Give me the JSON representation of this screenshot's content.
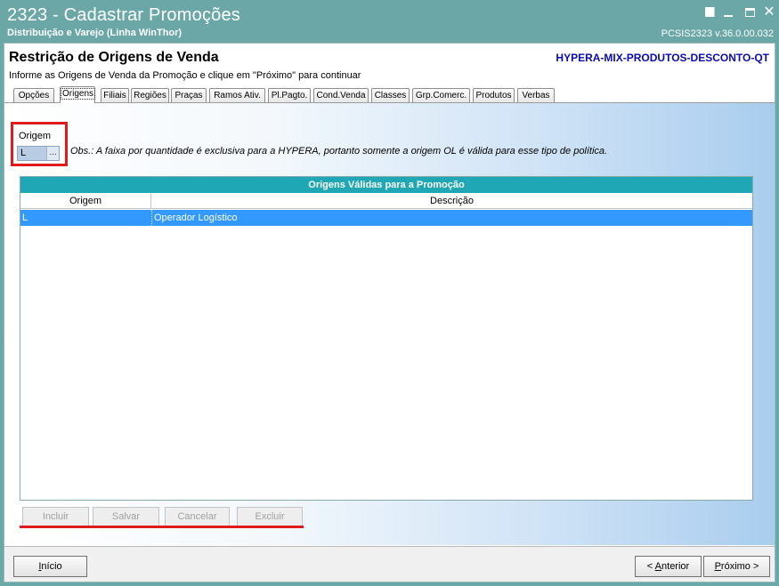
{
  "window": {
    "title": "2323 - Cadastrar Promoções",
    "subtitle": "Distribuição e Varejo (Linha WinThor)",
    "version": "PCSIS2323  v.36.0.00.032"
  },
  "header": {
    "title": "Restrição de Origens de Venda",
    "description": "Informe as Origens de Venda da Promoção e clique em \"Próximo\" para continuar",
    "policy_code": "HYPERA-MIX-PRODUTOS-DESCONTO-QT"
  },
  "tabs": [
    {
      "label": "Opções"
    },
    {
      "label": "Origens"
    },
    {
      "label": "Filiais"
    },
    {
      "label": "Regiões"
    },
    {
      "label": "Praças"
    },
    {
      "label": "Ramos Ativ."
    },
    {
      "label": "Pl.Pagto."
    },
    {
      "label": "Cond.Venda"
    },
    {
      "label": "Classes"
    },
    {
      "label": "Grp.Comerc."
    },
    {
      "label": "Produtos"
    },
    {
      "label": "Verbas"
    }
  ],
  "active_tab": "Origens",
  "origem": {
    "label": "Origem",
    "value": "L",
    "lookup_button": "...",
    "obs": "Obs.: A faixa por quantidade é exclusiva para a HYPERA, portanto somente a origem OL é válida para esse tipo de política."
  },
  "grid": {
    "title": "Origens Válidas para a Promoção",
    "columns": [
      "Origem",
      "Descrição"
    ],
    "rows": [
      {
        "origem": "L",
        "descricao": "Operador Logístico"
      }
    ]
  },
  "actions": {
    "incluir": "Incluir",
    "salvar": "Salvar",
    "cancelar": "Cancelar",
    "excluir": "Excluir"
  },
  "footer": {
    "inicio_u": "I",
    "inicio_rest": "nício",
    "anterior_pre": "< ",
    "anterior_u": "A",
    "anterior_rest": "nterior",
    "proximo_pre": "",
    "proximo_u": "P",
    "proximo_rest": "róximo >"
  },
  "colors": {
    "titlebar": "#6ba7a7",
    "grid_title": "#20a7b5",
    "selected_row": "#3399ff",
    "highlight": "#e01b1b",
    "policy_code": "#0a0ab5"
  }
}
